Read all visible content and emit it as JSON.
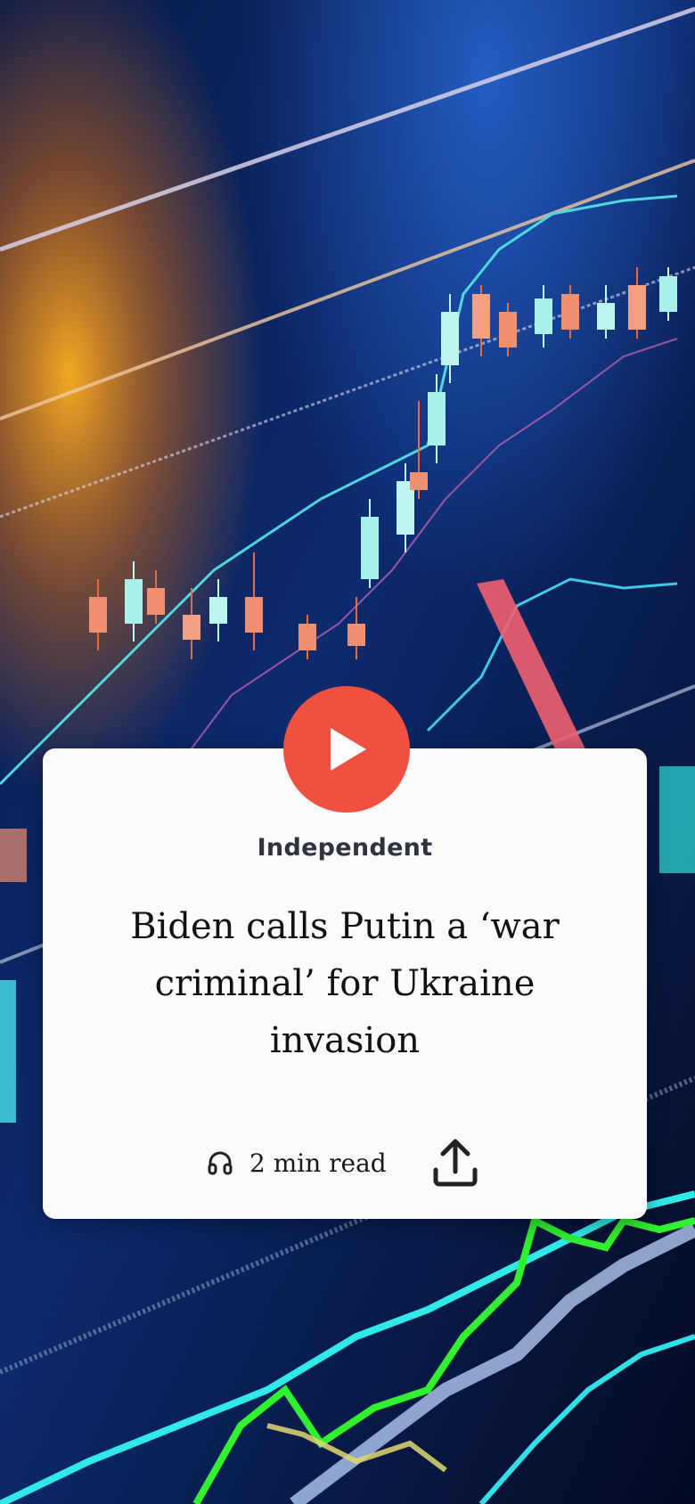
{
  "article": {
    "source": "Independent",
    "headline": "Biden calls Putin a ‘war criminal’ for Ukraine invasion",
    "read_time": "2 min read"
  },
  "icons": {
    "play": "play-icon",
    "headphones": "headphones-icon",
    "share": "share-icon"
  },
  "colors": {
    "play_button": "#ef5040",
    "card_background": "#fbfbfb",
    "source_text": "#2f3340",
    "headline_text": "#111111"
  }
}
